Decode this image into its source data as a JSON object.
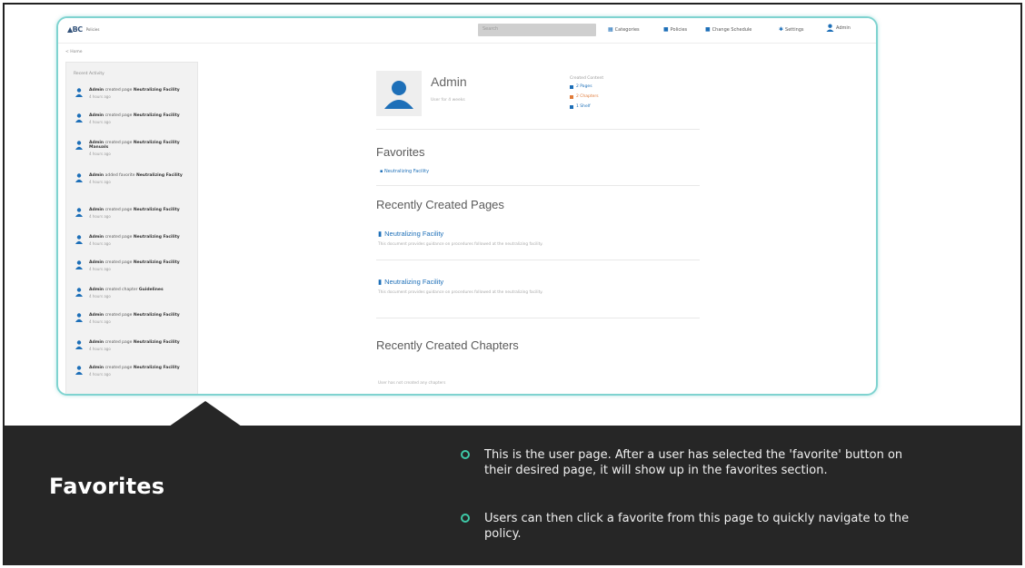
{
  "app": {
    "logo_text": "Policies",
    "search_placeholder": "Search",
    "nav": [
      "Categories",
      "Policies",
      "Change Schedule",
      "Settings"
    ],
    "user_menu": "Admin",
    "breadcrumb": "< Home"
  },
  "sidebar": {
    "heading": "Recent Activity",
    "items": [
      {
        "user": "Admin",
        "action": "created page",
        "target": "Neutralizing Facility",
        "time": "4 hours ago"
      },
      {
        "user": "Admin",
        "action": "created page",
        "target": "Neutralizing Facility",
        "time": "4 hours ago"
      },
      {
        "user": "Admin",
        "action": "created page",
        "target": "Neutralizing Facility Manuals",
        "time": "4 hours ago"
      },
      {
        "user": "Admin",
        "action": "added favorite",
        "target": "Neutralizing Facility",
        "time": "4 hours ago"
      },
      {
        "user": "Admin",
        "action": "created page",
        "target": "Neutralizing Facility",
        "time": "4 hours ago"
      },
      {
        "user": "Admin",
        "action": "created page",
        "target": "Neutralizing Facility",
        "time": "4 hours ago"
      },
      {
        "user": "Admin",
        "action": "created page",
        "target": "Neutralizing Facility",
        "time": "4 hours ago"
      },
      {
        "user": "Admin",
        "action": "created chapter",
        "target": "Guidelines",
        "time": "4 hours ago"
      },
      {
        "user": "Admin",
        "action": "created page",
        "target": "Neutralizing Facility",
        "time": "4 hours ago"
      },
      {
        "user": "Admin",
        "action": "created page",
        "target": "Neutralizing Facility",
        "time": "4 hours ago"
      },
      {
        "user": "Admin",
        "action": "created page",
        "target": "Neutralizing Facility",
        "time": "4 hours ago"
      }
    ]
  },
  "profile": {
    "name": "Admin",
    "subtitle": "User for 4 weeks",
    "stats_heading": "Created Content",
    "stats": [
      {
        "label": "2 Pages",
        "color": "#1d6fb8"
      },
      {
        "label": "2 Chapters",
        "color": "#e07b39"
      },
      {
        "label": "1 Shelf",
        "color": "#1d6fb8"
      }
    ]
  },
  "sections": {
    "favorites_title": "Favorites",
    "favorite_link": "Neutralizing Facility",
    "pages_title": "Recently Created Pages",
    "pages": [
      {
        "title": "Neutralizing Facility",
        "desc": "This document provides guidance on procedures followed at the neutralizing facility."
      },
      {
        "title": "Neutralizing Facility",
        "desc": "This document provides guidance on procedures followed at the neutralizing facility."
      }
    ],
    "chapters_title": "Recently Created Chapters",
    "chapters_desc": "User has not created any chapters"
  },
  "caption": {
    "title": "Favorites",
    "bullet_color": "#3ec9a7",
    "bullets": [
      "This is the user page. After a user has selected the 'favorite' button on their desired page, it will show up in the favorites section.",
      "Users can then click a favorite from this page to quickly navigate to the policy."
    ]
  }
}
